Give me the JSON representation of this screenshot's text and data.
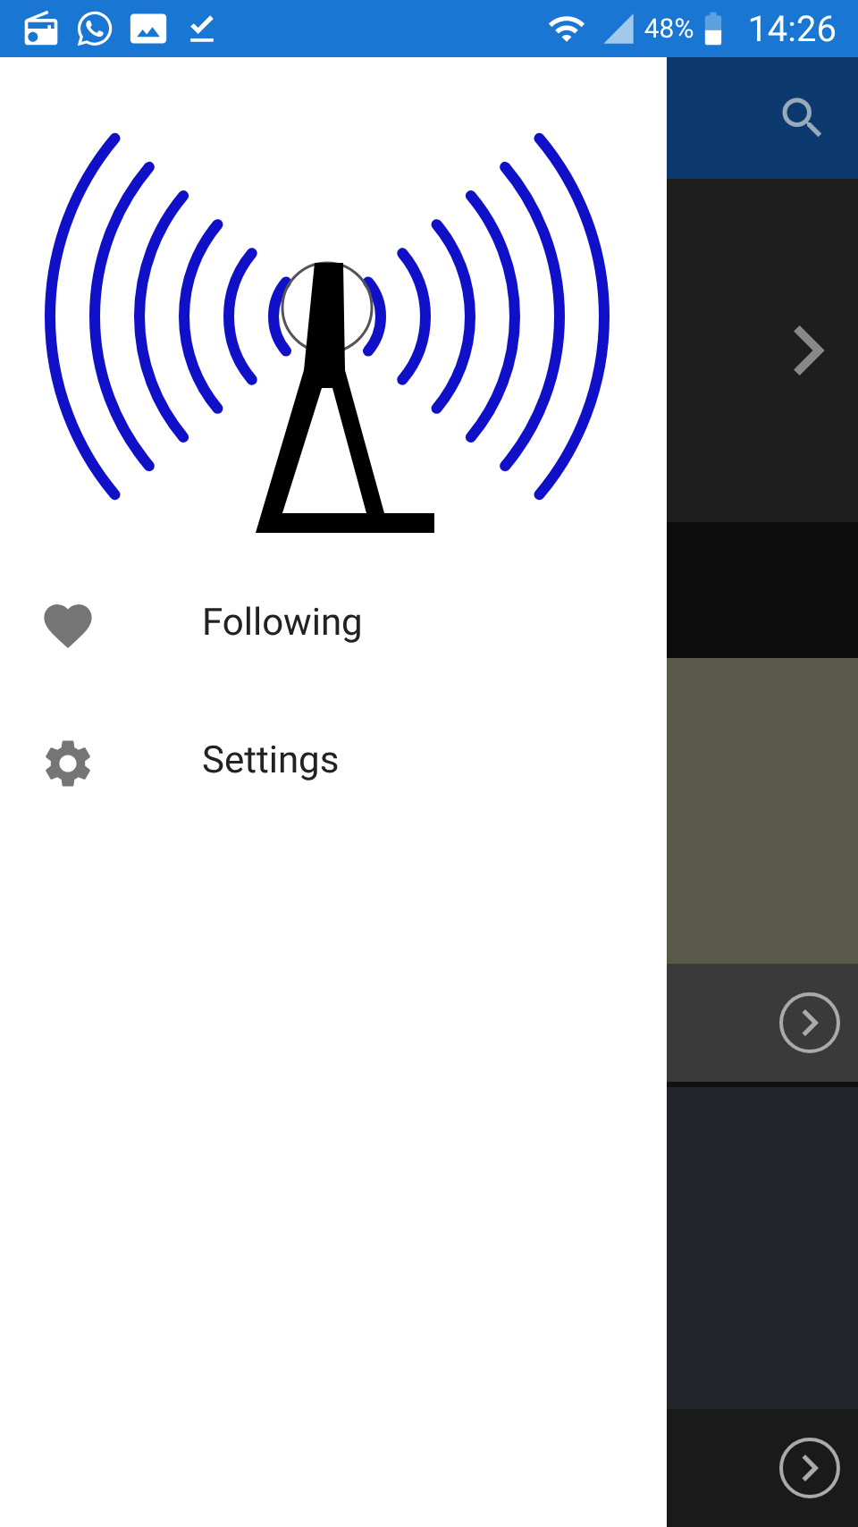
{
  "status_bar": {
    "battery": "48%",
    "time": "14:26"
  },
  "drawer": {
    "items": [
      {
        "label": "Following"
      },
      {
        "label": "Settings"
      }
    ]
  }
}
